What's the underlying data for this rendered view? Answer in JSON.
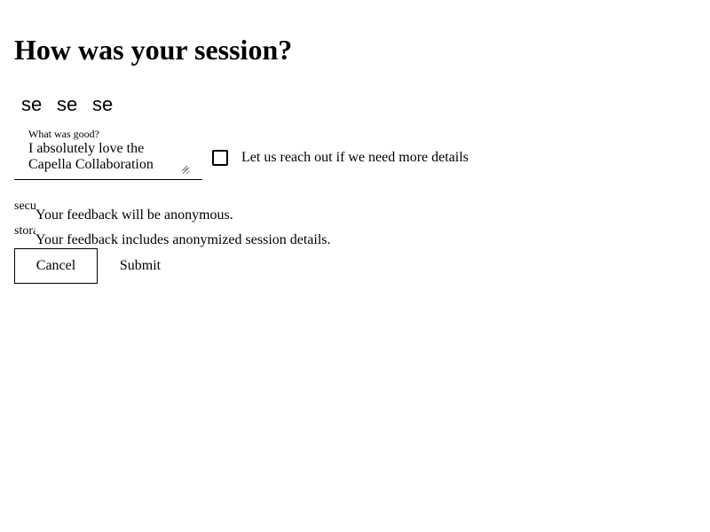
{
  "page": {
    "title": "How was your session?"
  },
  "rating": {
    "items": [
      {
        "label": "se",
        "icon": "sentiment-icon"
      },
      {
        "label": "se",
        "icon": "sentiment-icon"
      },
      {
        "label": "se",
        "icon": "sentiment-icon"
      }
    ]
  },
  "feedback": {
    "label": "What was good?",
    "value": "I absolutely love the Capella Collaboration"
  },
  "contact": {
    "label": "Let us reach out if we need more details",
    "checked": false
  },
  "notices": [
    {
      "icon_text": "security",
      "icon": "security-icon",
      "text": "Your feedback will be anonymous."
    },
    {
      "icon_text": "storage",
      "icon": "storage-icon",
      "text": "Your feedback includes anonymized session details."
    }
  ],
  "actions": {
    "cancel_label": "Cancel",
    "submit_label": "Submit"
  }
}
